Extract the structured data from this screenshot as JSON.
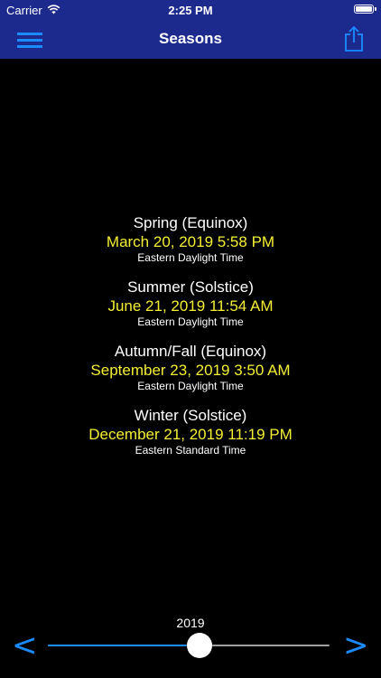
{
  "status_bar": {
    "carrier": "Carrier",
    "time": "2:25 PM",
    "icons": [
      "wifi-icon",
      "battery-icon"
    ]
  },
  "nav": {
    "title": "Seasons",
    "left_icon": "hamburger-menu-icon",
    "right_icon": "share-icon"
  },
  "seasons": [
    {
      "name": "Spring (Equinox)",
      "date": "March 20, 2019 5:58 PM",
      "timezone": "Eastern Daylight Time"
    },
    {
      "name": "Summer (Solstice)",
      "date": "June 21, 2019 11:54 AM",
      "timezone": "Eastern Daylight Time"
    },
    {
      "name": "Autumn/Fall (Equinox)",
      "date": "September 23, 2019 3:50 AM",
      "timezone": "Eastern Daylight Time"
    },
    {
      "name": "Winter (Solstice)",
      "date": "December 21, 2019 11:19 PM",
      "timezone": "Eastern Standard Time"
    }
  ],
  "year_selector": {
    "year": "2019",
    "prev_label": "<",
    "next_label": ">",
    "slider_fraction": 0.54
  },
  "colors": {
    "bar_background": "#1c2a8e",
    "accent": "#1a8cff",
    "date_text": "#f3ee34",
    "background": "#000000"
  }
}
